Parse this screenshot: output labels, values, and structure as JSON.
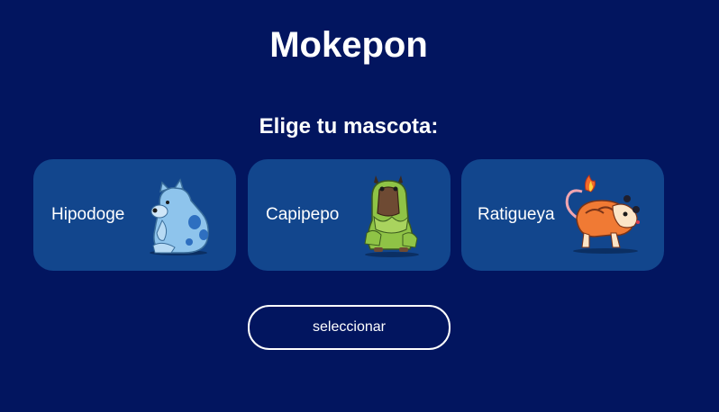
{
  "page": {
    "title": "Mokepon",
    "subtitle": "Elige tu mascota:"
  },
  "pets": [
    {
      "name": "Hipodoge",
      "image": "hipodoge-icon",
      "color": "#7fb6e6"
    },
    {
      "name": "Capipepo",
      "image": "capipepo-icon",
      "color": "#8fc346"
    },
    {
      "name": "Ratigueya",
      "image": "ratigueya-icon",
      "color": "#f07a34"
    }
  ],
  "actions": {
    "select_label": "seleccionar"
  },
  "colors": {
    "background": "#02155f",
    "card": "#12468d",
    "text": "#ffffff"
  }
}
